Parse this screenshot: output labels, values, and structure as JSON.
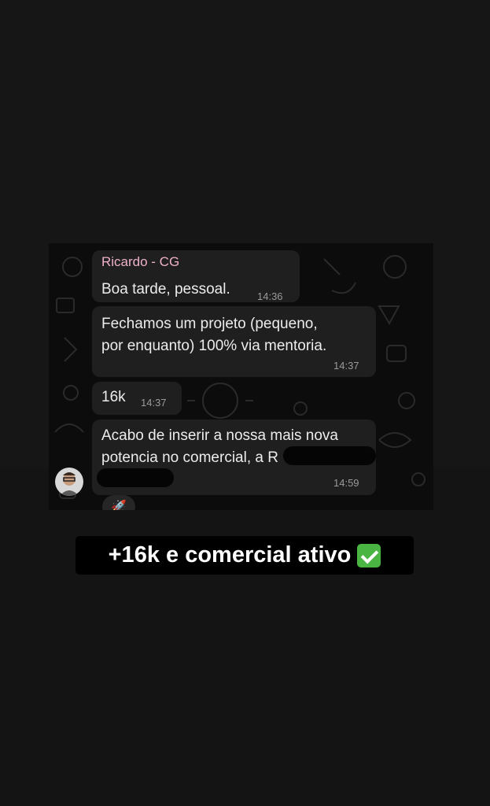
{
  "chat": {
    "messages": [
      {
        "sender": "Ricardo - CG",
        "text": "Boa tarde, pessoal.",
        "time": "14:36"
      },
      {
        "text": "Fechamos um projeto (pequeno,\npor enquanto) 100% via mentoria.",
        "time": "14:37"
      },
      {
        "text": "16k",
        "time": "14:37"
      },
      {
        "text": "Acabo de inserir a nossa mais nova\npotencia no comercial, a R",
        "time": "14:59"
      }
    ],
    "reaction": "🚀"
  },
  "caption": {
    "text": "+16k e comercial ativo",
    "icon": "check-mark-icon",
    "icon_color": "#4bb543"
  },
  "colors": {
    "background": "#141414",
    "bubble": "#1f1f1f",
    "sender_name": "#eeb1c9"
  }
}
